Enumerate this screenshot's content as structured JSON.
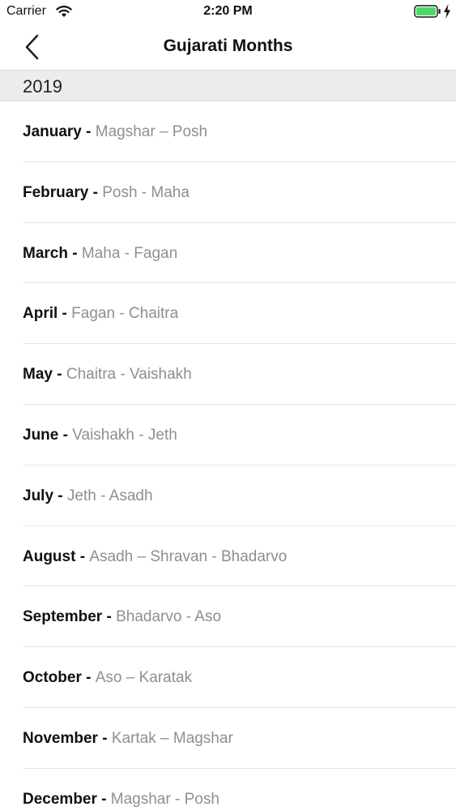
{
  "status_bar": {
    "carrier": "Carrier",
    "time": "2:20 PM",
    "battery_color": "#4cd964"
  },
  "nav": {
    "title": "Gujarati Months",
    "back_icon": "chevron-left-icon"
  },
  "section": {
    "title": "2019"
  },
  "separator": " - ",
  "months": [
    {
      "name": "January",
      "gujarati": "Magshar – Posh"
    },
    {
      "name": "February",
      "gujarati": "Posh - Maha"
    },
    {
      "name": "March",
      "gujarati": "Maha - Fagan"
    },
    {
      "name": "April",
      "gujarati": "Fagan - Chaitra"
    },
    {
      "name": "May",
      "gujarati": "Chaitra - Vaishakh"
    },
    {
      "name": "June",
      "gujarati": "Vaishakh - Jeth"
    },
    {
      "name": "July",
      "gujarati": "Jeth - Asadh"
    },
    {
      "name": "August",
      "gujarati": "Asadh – Shravan - Bhadarvo"
    },
    {
      "name": "September",
      "gujarati": "Bhadarvo - Aso"
    },
    {
      "name": "October",
      "gujarati": "Aso – Karatak"
    },
    {
      "name": "November",
      "gujarati": "Kartak – Magshar"
    },
    {
      "name": "December",
      "gujarati": "Magshar - Posh"
    }
  ]
}
